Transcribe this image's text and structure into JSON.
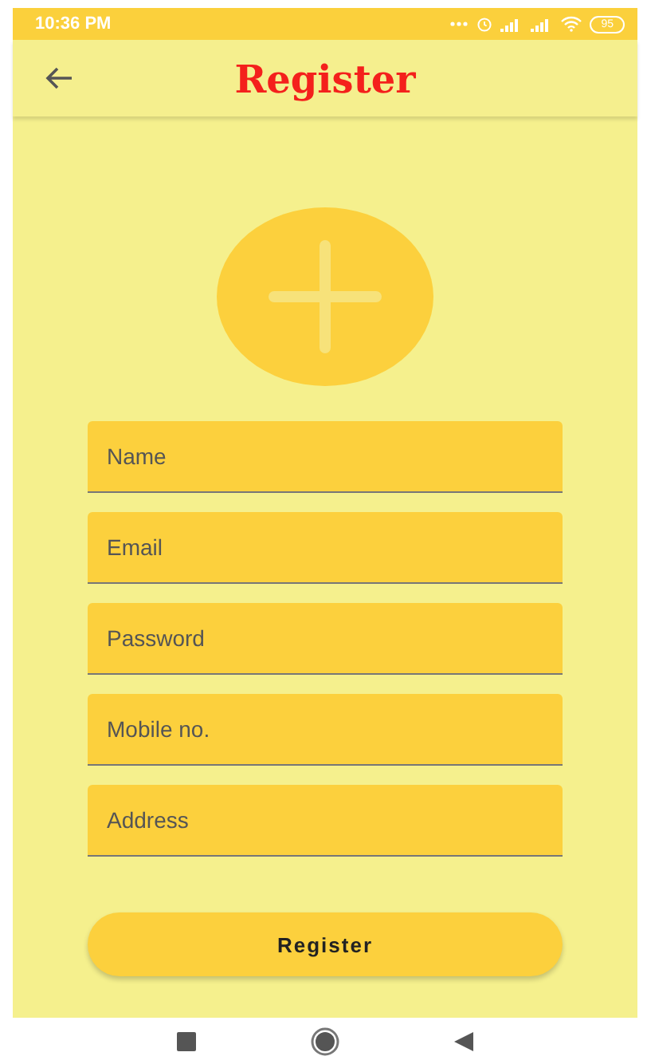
{
  "status_bar": {
    "time": "10:36 PM",
    "battery": "95"
  },
  "app_bar": {
    "title": "Register"
  },
  "fields": [
    {
      "placeholder": "Name"
    },
    {
      "placeholder": "Email"
    },
    {
      "placeholder": "Password"
    },
    {
      "placeholder": "Mobile no."
    },
    {
      "placeholder": "Address"
    }
  ],
  "submit_button": {
    "label": "Register"
  }
}
